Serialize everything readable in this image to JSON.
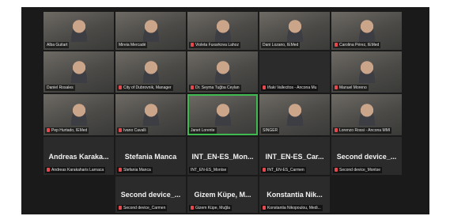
{
  "meeting": {
    "video_tiles": [
      {
        "label": "Alba Guitart",
        "muted": false
      },
      {
        "label": "Mireia Mercadé",
        "muted": false
      },
      {
        "label": "Violeta Fuxarkova Lahoz",
        "muted": true
      },
      {
        "label": "Dani Lozano, IEMed",
        "muted": false
      },
      {
        "label": "Carolina Pérez, IEMed",
        "muted": true
      },
      {
        "label": "Daniel Rosales",
        "muted": false
      },
      {
        "label": "City of Dubrovnik, Manager",
        "muted": true
      },
      {
        "label": "Dr. Seyma Tuğba Ceylan",
        "muted": true
      },
      {
        "label": "Iñaki Vallecitos - Ancona Mu",
        "muted": true
      },
      {
        "label": "Manuel Moreno",
        "muted": true
      },
      {
        "label": "Pep Hurtado, IEMed",
        "muted": true
      },
      {
        "label": "Ivano Cavalli",
        "muted": true
      },
      {
        "label": "Janet Lorente",
        "muted": false
      },
      {
        "label": "SINGER",
        "muted": false
      },
      {
        "label": "Lorenzo Rossi - Ancona MMI",
        "muted": true
      }
    ],
    "name_tiles": [
      {
        "display_name": "Andreas Karaka...",
        "label": "Andreas Karakaharis Larnaca"
      },
      {
        "display_name": "Stefania Manca",
        "label": "Stefania Manca"
      },
      {
        "display_name": "INT_EN-ES_Mon...",
        "label": "INT_EN-ES_Montse"
      },
      {
        "display_name": "INT_EN-ES_Car...",
        "label": "INT_EN-ES_Carmen"
      },
      {
        "display_name": "Second device_...",
        "label": "Second device_Montse"
      },
      {
        "display_name": "Second device_...",
        "label": "Second device_Carmen"
      },
      {
        "display_name": "Gizem Küpe, M...",
        "label": "Gizem Küpe, Muğla"
      },
      {
        "display_name": "Konstantia Nik...",
        "label": "Konstantia Nikopoulou, Medi..."
      }
    ]
  }
}
